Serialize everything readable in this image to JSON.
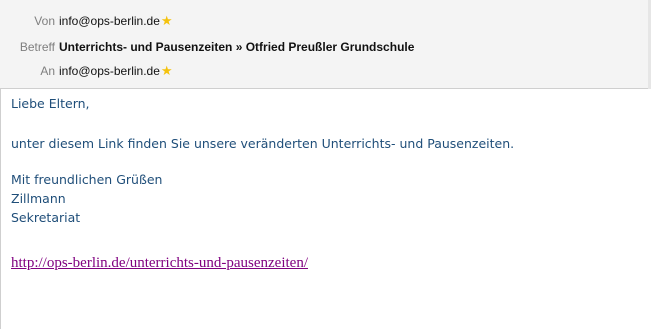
{
  "header": {
    "from_label": "Von",
    "from_value": "info@ops-berlin.de",
    "subject_label": "Betreff",
    "subject_value": "Unterrichts- und Pausenzeiten » Otfried Preußler Grundschule",
    "to_label": "An",
    "to_value": "info@ops-berlin.de",
    "star_glyph": "★"
  },
  "message": {
    "greeting": "Liebe Eltern,",
    "line1": "unter diesem Link finden Sie unsere veränderten Unterrichts- und Pausenzeiten.",
    "closing": "Mit freundlichen Grüßen",
    "name": "Zillmann",
    "department": "Sekretariat",
    "link": "http://ops-berlin.de/unterrichts-und-pausenzeiten/"
  },
  "colors": {
    "body_text": "#1f4e79",
    "link": "#800080",
    "header_bg": "#f4f4f4",
    "label": "#7f7f7f",
    "star": "#f4c20d"
  }
}
